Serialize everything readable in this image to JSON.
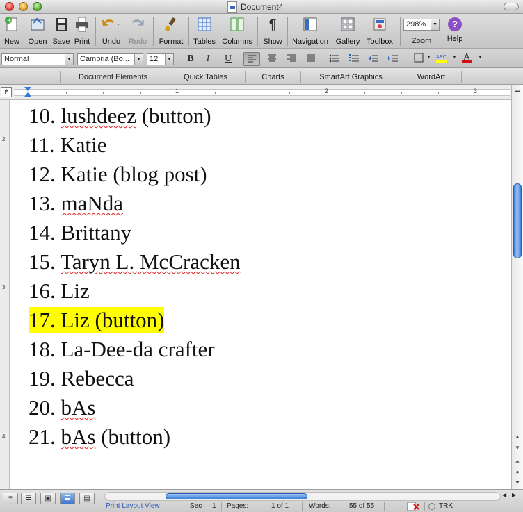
{
  "window": {
    "title": "Document4"
  },
  "toolbar": {
    "buttons": [
      {
        "label": "New",
        "icon": "new-document-icon"
      },
      {
        "label": "Open",
        "icon": "open-folder-icon"
      },
      {
        "label": "Save",
        "icon": "save-disk-icon"
      },
      {
        "label": "Print",
        "icon": "printer-icon"
      },
      {
        "label": "Undo",
        "icon": "undo-arrow-icon"
      },
      {
        "label": "Redo",
        "icon": "redo-arrow-icon"
      },
      {
        "label": "Format",
        "icon": "format-brush-icon"
      },
      {
        "label": "Tables",
        "icon": "table-grid-icon"
      },
      {
        "label": "Columns",
        "icon": "columns-icon"
      },
      {
        "label": "Show",
        "icon": "pilcrow-icon"
      },
      {
        "label": "Navigation",
        "icon": "navigation-pane-icon"
      },
      {
        "label": "Gallery",
        "icon": "gallery-icon"
      },
      {
        "label": "Toolbox",
        "icon": "toolbox-icon"
      },
      {
        "label": "Zoom",
        "icon": ""
      },
      {
        "label": "Help",
        "icon": "help-icon"
      }
    ],
    "zoom_value": "298%"
  },
  "format": {
    "style": "Normal",
    "font": "Cambria (Bo...",
    "size": "12",
    "bold": "B",
    "italic": "I",
    "underline": "U",
    "highlight_color": "#ffff00",
    "font_color": "#d01010"
  },
  "ribbon": {
    "tabs": [
      "Document Elements",
      "Quick Tables",
      "Charts",
      "SmartArt Graphics",
      "WordArt"
    ]
  },
  "ruler": {
    "marks": [
      "1",
      "2",
      "3"
    ]
  },
  "vruler": {
    "marks": [
      "2",
      "3",
      "4"
    ]
  },
  "document": {
    "lines": [
      {
        "num": "10.",
        "text": "lushdeez",
        "suffix": " (button)",
        "spell": true,
        "highlight": false
      },
      {
        "num": "11.",
        "text": "Katie",
        "suffix": "",
        "spell": false,
        "highlight": false
      },
      {
        "num": "12.",
        "text": "Katie (blog post)",
        "suffix": "",
        "spell": false,
        "highlight": false
      },
      {
        "num": "13.",
        "text": "maNda",
        "suffix": "",
        "spell": true,
        "highlight": false
      },
      {
        "num": "14.",
        "text": "Brittany",
        "suffix": "",
        "spell": false,
        "highlight": false
      },
      {
        "num": "15.",
        "text": "Taryn L. McCracken",
        "suffix": "",
        "spell": true,
        "highlight": false
      },
      {
        "num": "16.",
        "text": "Liz",
        "suffix": "",
        "spell": false,
        "highlight": false
      },
      {
        "num": "17.",
        "text": "Liz (button)",
        "suffix": "",
        "spell": false,
        "highlight": true
      },
      {
        "num": "18.",
        "text": "La-Dee-da crafter",
        "suffix": "",
        "spell": false,
        "highlight": false
      },
      {
        "num": "19.",
        "text": "Rebecca",
        "suffix": "",
        "spell": false,
        "highlight": false
      },
      {
        "num": "20.",
        "text": "bAs",
        "suffix": "",
        "spell": true,
        "highlight": false
      },
      {
        "num": "21.",
        "text": "bAs",
        "suffix": " (button)",
        "spell": true,
        "highlight": false
      }
    ]
  },
  "status": {
    "view_name": "Print Layout View",
    "sec_label": "Sec",
    "sec_value": "1",
    "pages_label": "Pages:",
    "pages_value": "1 of 1",
    "words_label": "Words:",
    "words_value": "55 of 55",
    "trk": "TRK"
  }
}
